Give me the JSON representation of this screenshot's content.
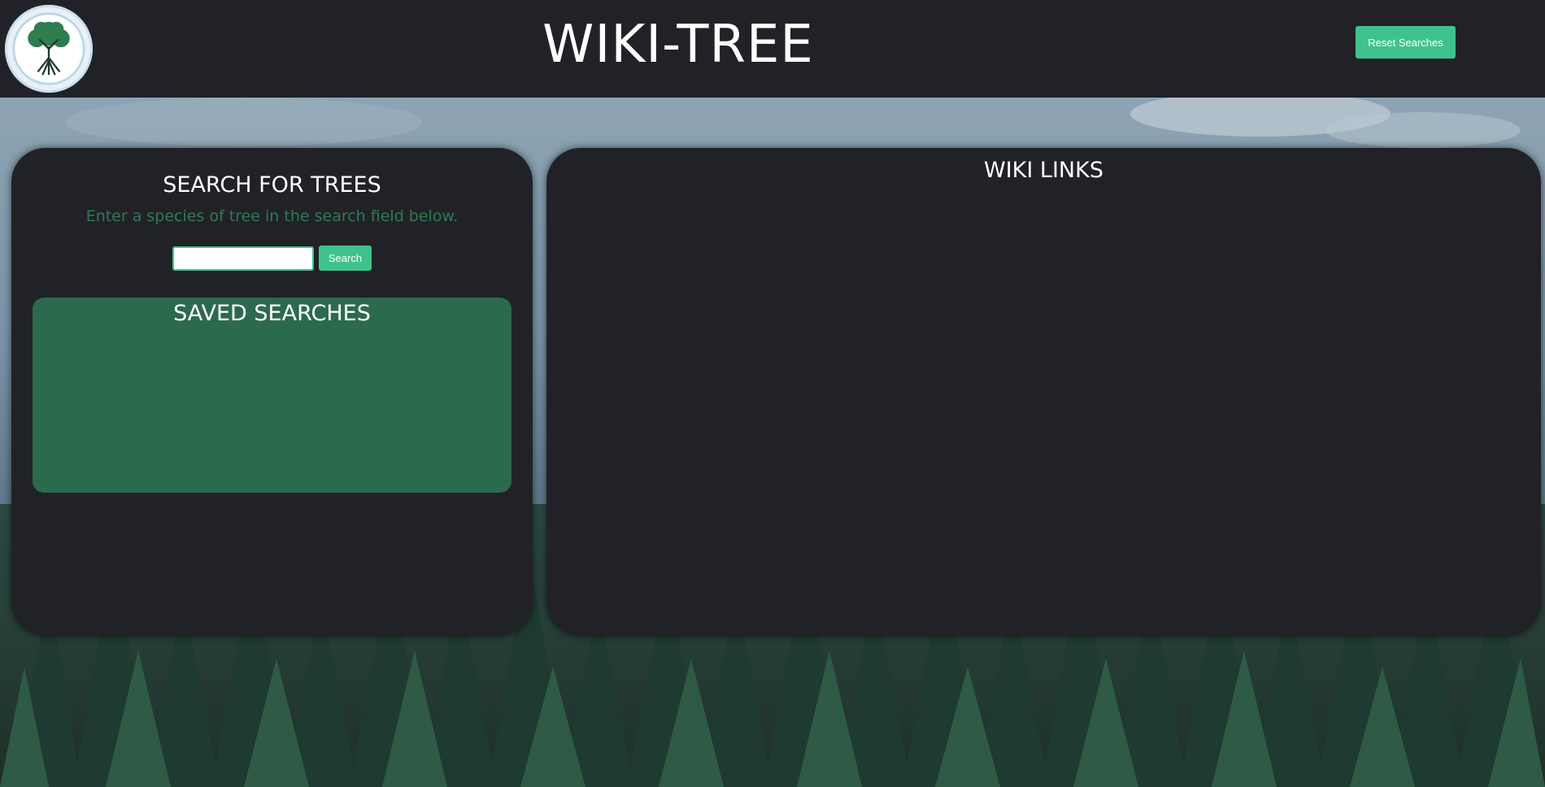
{
  "header": {
    "title": "WIKI-TREE",
    "reset_label": "Reset Searches"
  },
  "search": {
    "heading": "SEARCH FOR TREES",
    "subtext": "Enter a species of tree in the search field below.",
    "input_value": "",
    "button_label": "Search"
  },
  "saved": {
    "heading": "SAVED SEARCHES"
  },
  "wiki": {
    "heading": "WIKI LINKS"
  },
  "colors": {
    "panel_bg": "#202227",
    "accent_green": "#3fc38c",
    "saved_box_green": "#2c6a4e",
    "subtext_green": "#2f7a53"
  },
  "icons": {
    "logo": "tree-of-life-icon"
  }
}
